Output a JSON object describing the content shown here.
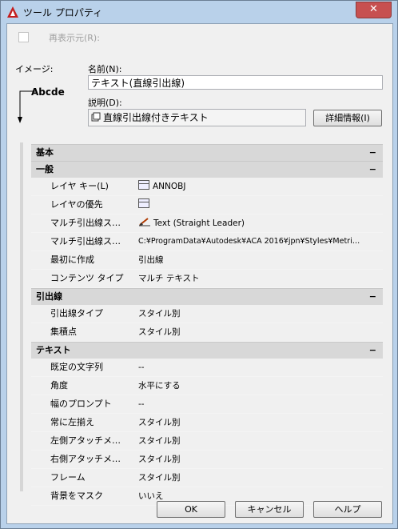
{
  "window": {
    "title": "ツール プロパティ",
    "close_label": "✕"
  },
  "reshow": {
    "label": "再表示元(R):"
  },
  "image": {
    "label": "イメージ:",
    "preview_text": "Abcde"
  },
  "name": {
    "label": "名前(N):",
    "value": "テキスト(直線引出線)"
  },
  "description": {
    "label": "説明(D):",
    "value": "直線引出線付きテキスト",
    "details_button": "詳細情報(I)"
  },
  "sections": {
    "basic": {
      "title": "基本",
      "toggle": "−"
    },
    "general": {
      "title": "一般",
      "toggle": "−",
      "rows": [
        {
          "label": "レイヤ キー(L)",
          "value": "ANNOBJ"
        },
        {
          "label": "レイヤの優先",
          "value": ""
        },
        {
          "label": "マルチ引出線ス…",
          "value": "Text (Straight Leader)"
        },
        {
          "label": "マルチ引出線ス…",
          "value": "C:¥ProgramData¥Autodesk¥ACA  2016¥jpn¥Styles¥Metri…"
        },
        {
          "label": "最初に作成",
          "value": "引出線"
        },
        {
          "label": "コンテンツ タイプ",
          "value": "マルチ テキスト"
        }
      ]
    },
    "leader": {
      "title": "引出線",
      "toggle": "−",
      "rows": [
        {
          "label": "引出線タイプ",
          "value": "スタイル別"
        },
        {
          "label": "集積点",
          "value": "スタイル別"
        }
      ]
    },
    "text": {
      "title": "テキスト",
      "toggle": "−",
      "rows": [
        {
          "label": "既定の文字列",
          "value": "--"
        },
        {
          "label": "角度",
          "value": "水平にする"
        },
        {
          "label": "幅のプロンプト",
          "value": "--"
        },
        {
          "label": "常に左揃え",
          "value": "スタイル別"
        },
        {
          "label": "左側アタッチメ…",
          "value": "スタイル別"
        },
        {
          "label": "右側アタッチメ…",
          "value": "スタイル別"
        },
        {
          "label": "フレーム",
          "value": "スタイル別"
        },
        {
          "label": "背景をマスク",
          "value": "いいえ"
        }
      ]
    }
  },
  "buttons": {
    "ok": "OK",
    "cancel": "キャンセル",
    "help": "ヘルプ"
  }
}
